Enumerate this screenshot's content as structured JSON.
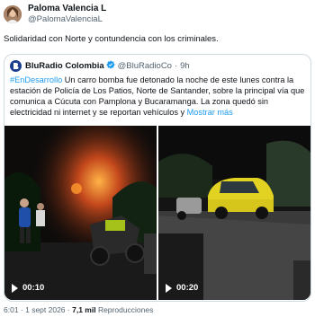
{
  "author": {
    "display_name": "Paloma Valencia L",
    "handle": "@PalomaValenciaL"
  },
  "tweet": {
    "text": "Solidaridad con Norte y contundencia con los criminales."
  },
  "quoted": {
    "name": "BluRadio Colombia",
    "handle": "@BluRadioCo",
    "separator": "·",
    "time": "9h",
    "hashtag": "#EnDesarrollo",
    "body": " Un carro bomba fue detonado la noche de este lunes contra la estación de Policía de Los Patios, Norte de Santander, sobre la principal vía que comunica a Cúcuta con Pamplona y Bucaramanga. La zona quedó sin electricidad ni internet y se reportan vehículos y ",
    "show_more": "Mostrar más",
    "videos": [
      {
        "duration": "00:10"
      },
      {
        "duration": "00:20"
      }
    ]
  },
  "footer": {
    "time": "6:01",
    "dot": " · ",
    "date": "1 sept 2026",
    "views_count": "7,1 mil",
    "views_label": " Reproducciones"
  },
  "colors": {
    "accent": "#1d9bf0",
    "secondary_text": "#536471",
    "border": "#cfd9de",
    "verified": "#1d9bf0"
  }
}
